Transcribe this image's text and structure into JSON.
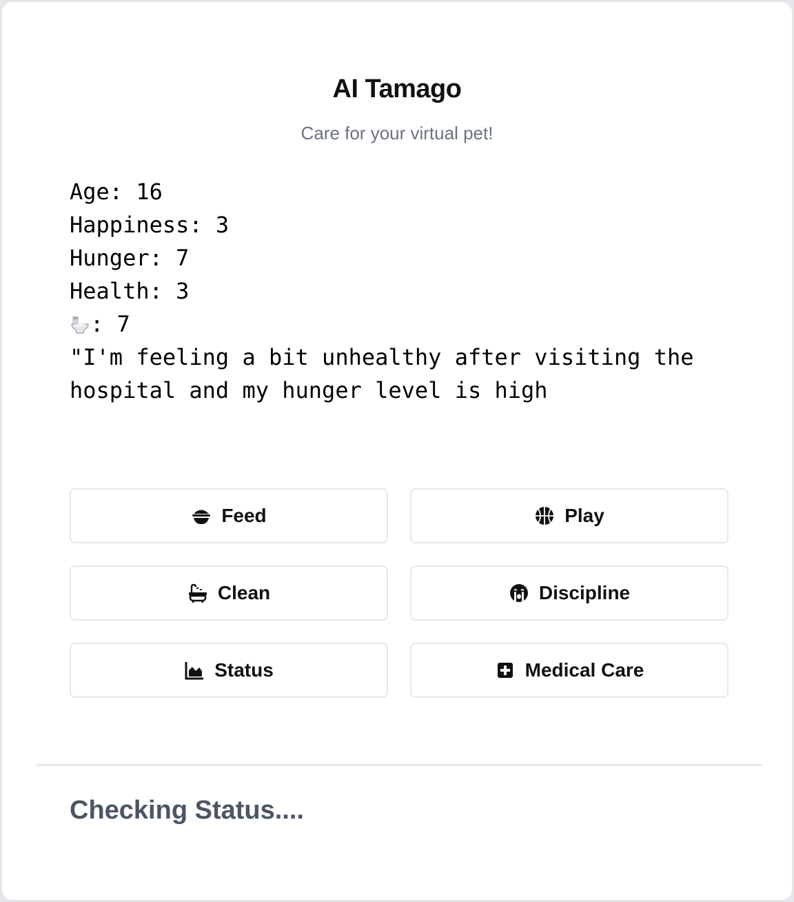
{
  "app": {
    "title": "AI Tamago",
    "subtitle": "Care for your virtual pet!"
  },
  "pet": {
    "age_line": "Age: 16",
    "happiness_line": "Happiness: 3",
    "hunger_line": "Hunger: 7",
    "health_line": "Health: 3",
    "poop_icon": "toilet-icon",
    "poop_value": ": 7",
    "message": "\"I'm feeling a bit unhealthy after visiting the hospital and my hunger level is high"
  },
  "actions": {
    "feed": {
      "label": "Feed",
      "icon": "bowl-icon"
    },
    "play": {
      "label": "Play",
      "icon": "basketball-icon"
    },
    "clean": {
      "label": "Clean",
      "icon": "bath-icon"
    },
    "discipline": {
      "label": "Discipline",
      "icon": "crying-face-icon"
    },
    "status": {
      "label": "Status",
      "icon": "area-chart-icon"
    },
    "medical": {
      "label": "Medical Care",
      "icon": "medical-kit-icon"
    }
  },
  "footer": {
    "status_message": "Checking Status...."
  },
  "colors": {
    "card_background": "#ffffff",
    "border": "#e5e7eb",
    "subtitle_text": "#6b7280",
    "footer_text": "#4b5563"
  }
}
